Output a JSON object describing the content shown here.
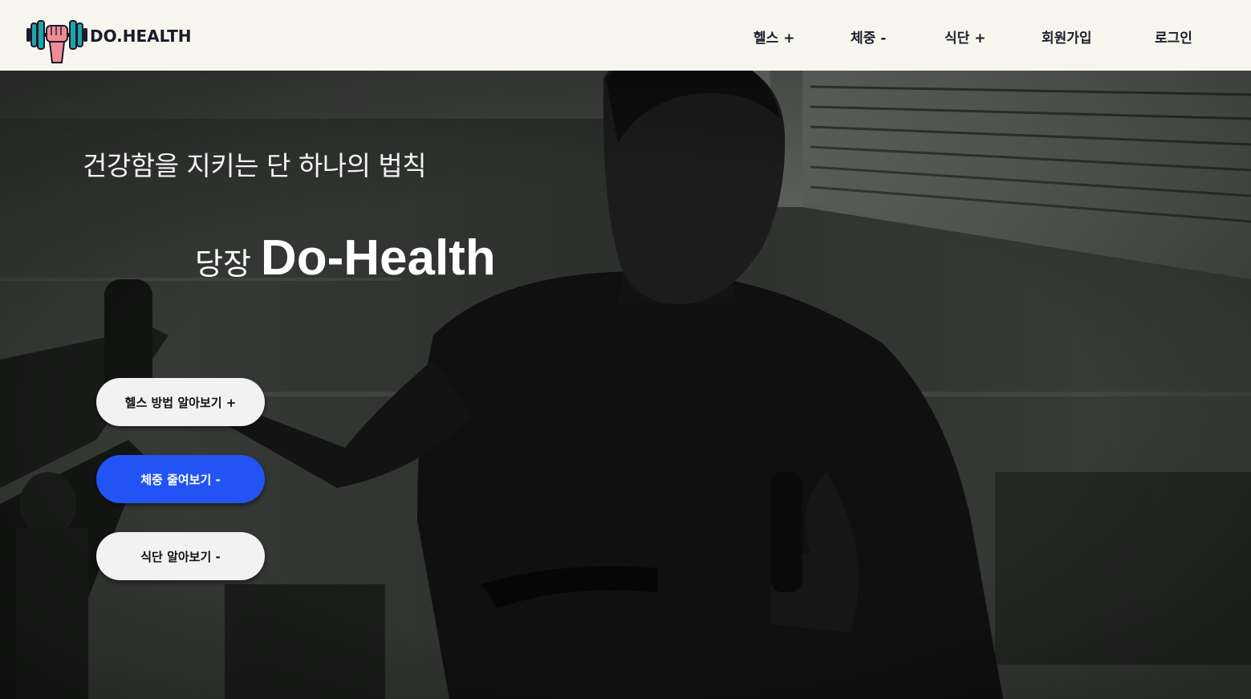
{
  "header": {
    "logo_text": "DO.HEALTH",
    "nav": [
      {
        "label": "헬스 +"
      },
      {
        "label": "체중 -"
      },
      {
        "label": "식단 +"
      },
      {
        "label": "회원가입"
      },
      {
        "label": "로그인"
      }
    ]
  },
  "hero": {
    "tagline": "건강함을 지키는 단 하나의 법칙",
    "headline_prefix": "당장",
    "headline_brand": "Do-Health",
    "buttons": [
      {
        "label": "헬스 방법 알아보기 +",
        "style": "light"
      },
      {
        "label": "체중 줄여보기 -",
        "style": "primary"
      },
      {
        "label": "식단 알아보기 -",
        "style": "light"
      }
    ]
  },
  "colors": {
    "header_bg": "#f7f6ee",
    "primary_button": "#2254f5",
    "light_button": "#f2f2f2",
    "nav_text": "#1c1c2c"
  },
  "icons": {
    "logo": "dumbbell-fist-icon"
  }
}
